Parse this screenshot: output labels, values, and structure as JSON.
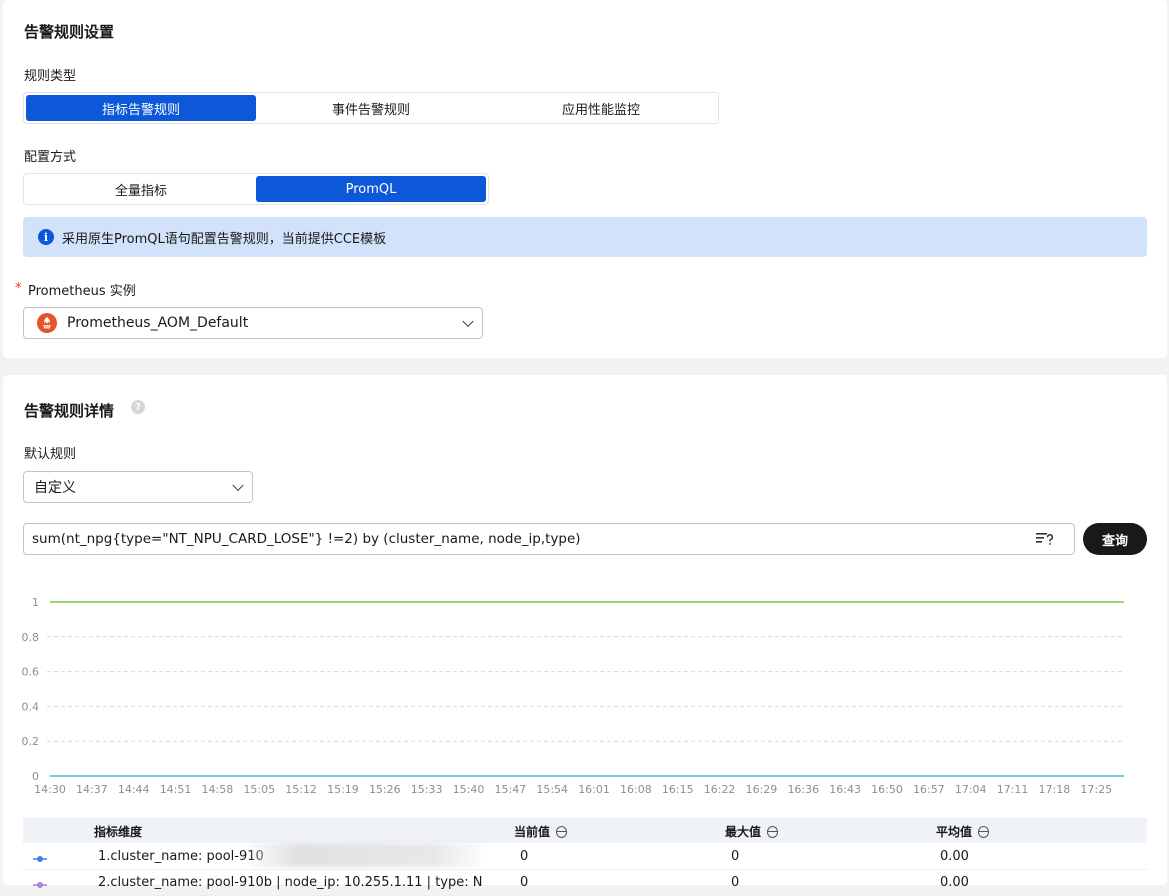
{
  "settings": {
    "title": "告警规则设置",
    "rule_type_label": "规则类型",
    "rule_types": [
      "指标告警规则",
      "事件告警规则",
      "应用性能监控"
    ],
    "config_label": "配置方式",
    "config_modes": [
      "全量指标",
      "PromQL"
    ],
    "info_text": "采用原生PromQL语句配置告警规则，当前提供CCE模板",
    "instance_label": "Prometheus 实例",
    "required_mark": "*",
    "instance_value": "Prometheus_AOM_Default"
  },
  "details": {
    "title": "告警规则详情",
    "default_rule_label": "默认规则",
    "default_rule_value": "自定义",
    "query": "sum(nt_npg{type=\"NT_NPU_CARD_LOSE\"} !=2) by (cluster_name, node_ip,type)",
    "query_button": "查询"
  },
  "chart_data": {
    "type": "line",
    "x": [
      "14:30",
      "14:37",
      "14:44",
      "14:51",
      "14:58",
      "15:05",
      "15:12",
      "15:19",
      "15:26",
      "15:33",
      "15:40",
      "15:47",
      "15:54",
      "16:01",
      "16:08",
      "16:15",
      "16:22",
      "16:29",
      "16:36",
      "16:43",
      "16:50",
      "16:57",
      "17:04",
      "17:11",
      "17:18",
      "17:25"
    ],
    "y_ticks": [
      "0",
      "0.2",
      "0.4",
      "0.6",
      "0.8",
      "1"
    ],
    "ylim": [
      0,
      1
    ],
    "grid": true,
    "series": [
      {
        "color": "#7ac943",
        "constant": 1
      },
      {
        "color": "#4db6e8",
        "constant": 0
      }
    ]
  },
  "table": {
    "headers": [
      "指标维度",
      "当前值",
      "最大值",
      "平均值"
    ],
    "rows": [
      {
        "dim": "1.cluster_name: pool-910",
        "current": "0",
        "max": "0",
        "avg": "0.00",
        "color": "#4b7bf5"
      },
      {
        "dim": "2.cluster_name: pool-910b | node_ip: 10.255.1.11 | type: N",
        "current": "0",
        "max": "0",
        "avg": "0.00",
        "color": "#b07fe0"
      }
    ]
  }
}
